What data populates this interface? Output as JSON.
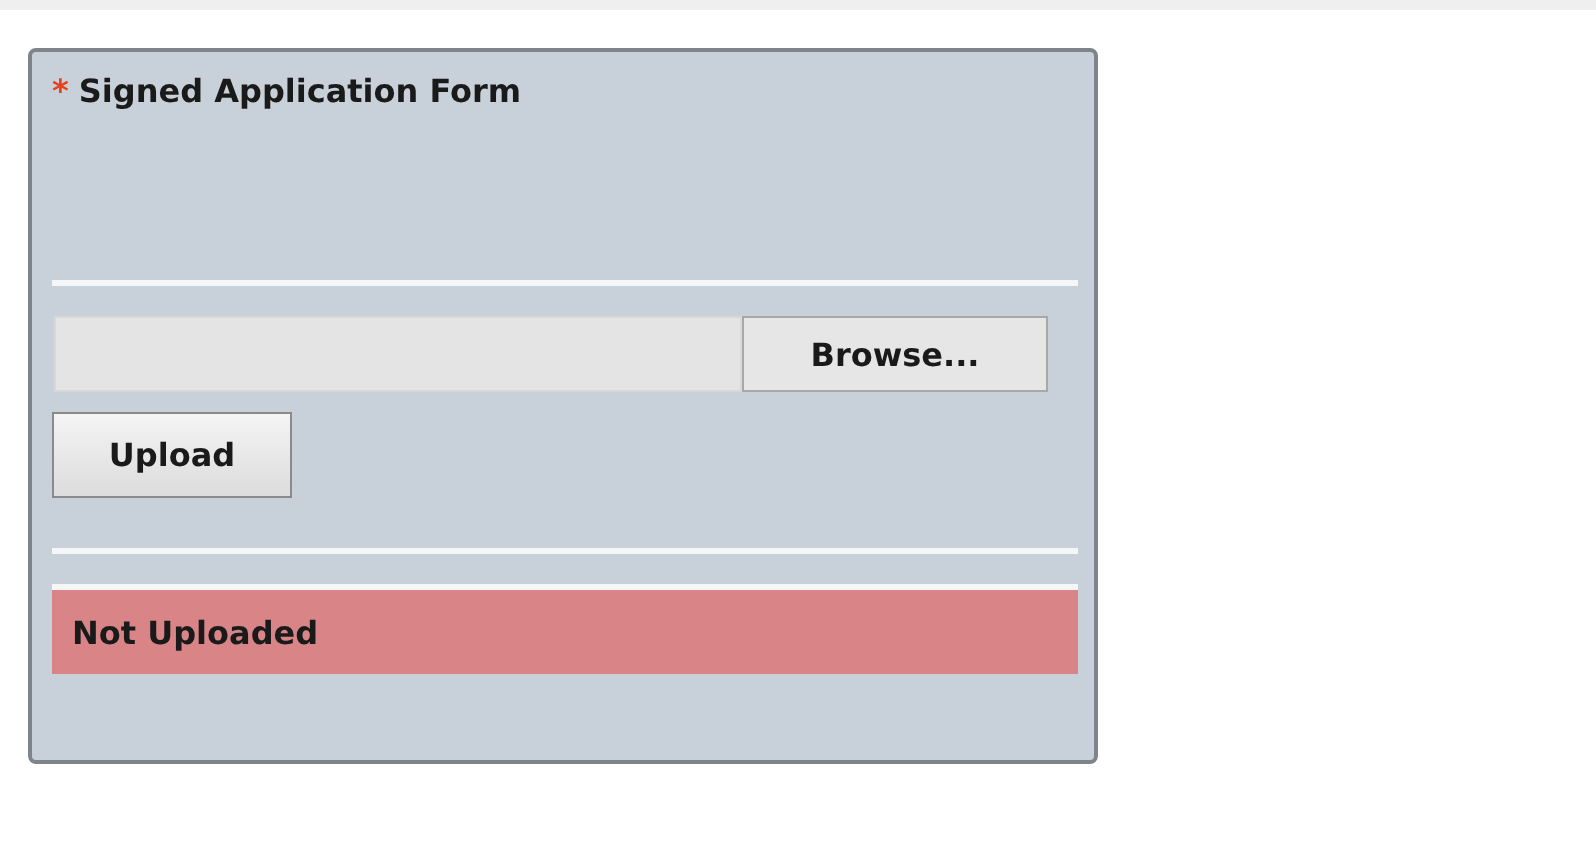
{
  "card": {
    "required_mark": "*",
    "title": "Signed Application Form",
    "file_field": {
      "browse_label": "Browse..."
    },
    "upload_button": "Upload",
    "status": {
      "text": "Not Uploaded",
      "uploaded": false
    }
  }
}
